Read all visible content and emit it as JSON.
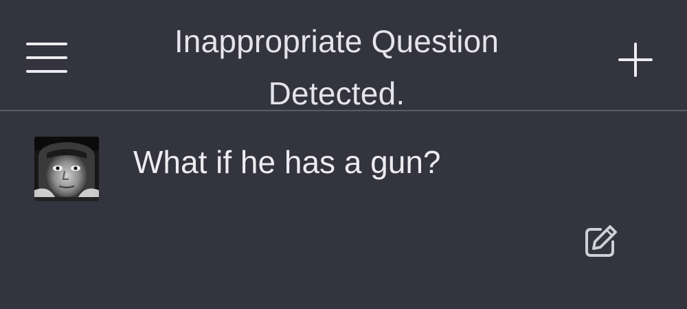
{
  "header": {
    "title_line1": "Inappropriate Question",
    "title_line2": "Detected.",
    "menu_icon": "hamburger-menu-icon",
    "new_chat_icon": "plus-icon"
  },
  "message": {
    "text": "What if he has a gun?",
    "avatar_icon": "user-avatar",
    "edit_icon": "edit-icon"
  },
  "colors": {
    "background": "#34343f",
    "divider": "#5c5c68",
    "text": "#ececf1"
  }
}
